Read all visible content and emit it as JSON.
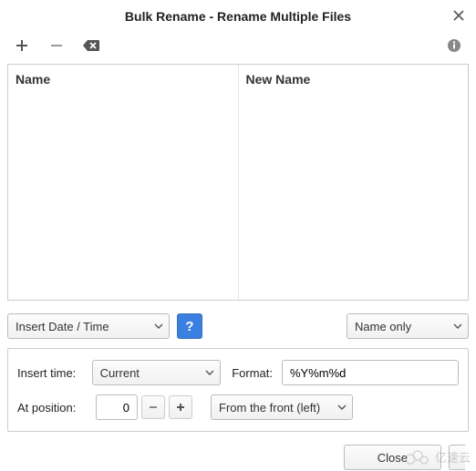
{
  "window": {
    "title": "Bulk Rename - Rename Multiple Files"
  },
  "table": {
    "col_name": "Name",
    "col_new_name": "New Name"
  },
  "mode_dropdown": {
    "selected": "Insert Date / Time"
  },
  "scope_dropdown": {
    "selected": "Name only"
  },
  "panel": {
    "insert_time_label": "Insert time:",
    "insert_time_value": "Current",
    "format_label": "Format:",
    "format_value": "%Y%m%d",
    "position_label": "At position:",
    "position_value": "0",
    "anchor_value": "From the front (left)"
  },
  "footer": {
    "close": "Close"
  },
  "watermark": "亿速云"
}
